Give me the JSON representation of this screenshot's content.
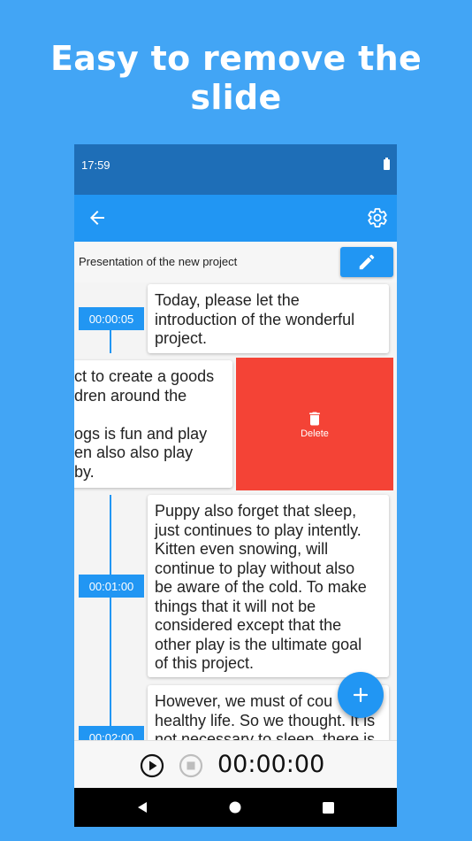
{
  "headline": "Easy to remove the slide",
  "status_bar": {
    "time": "17:59",
    "battery_icon": "battery-icon"
  },
  "app_bar": {
    "back_icon": "arrow-back-icon",
    "settings_icon": "gear-icon",
    "color": "#2196f3"
  },
  "project": {
    "title": "Presentation of the new project",
    "edit_icon": "pencil-icon"
  },
  "slides": [
    {
      "time": "00:00:05",
      "text": "Today, please let the\nintroduction of the wonderful\nproject."
    },
    {
      "time": "",
      "text": "ct to create a goods\ndren around the\n\nogs is fun and play\nen also also play\nby."
    },
    {
      "time": "00:01:00",
      "text": "Puppy also forget that sleep,\njust continues to play intently.\nKitten even snowing, will\ncontinue to play without also\nbe aware of the cold. To make\nthings that it will not be\nconsidered except that the\nother play is the ultimate goal\nof this project."
    },
    {
      "time": "00:02:00",
      "text": "However, we must of cou\nhealthy life. So we thought. It is\nnot necessary to sleep, there is"
    }
  ],
  "delete_action": {
    "label": "Delete",
    "icon": "trash-icon",
    "color": "#f44336"
  },
  "fab": {
    "icon": "plus-icon"
  },
  "player": {
    "time": "00:00:00",
    "play_icon": "play-icon",
    "stop_icon": "stop-icon"
  },
  "nav_bar": {
    "back_icon": "nav-back-icon",
    "home_icon": "nav-home-icon",
    "recents_icon": "nav-recents-icon"
  }
}
